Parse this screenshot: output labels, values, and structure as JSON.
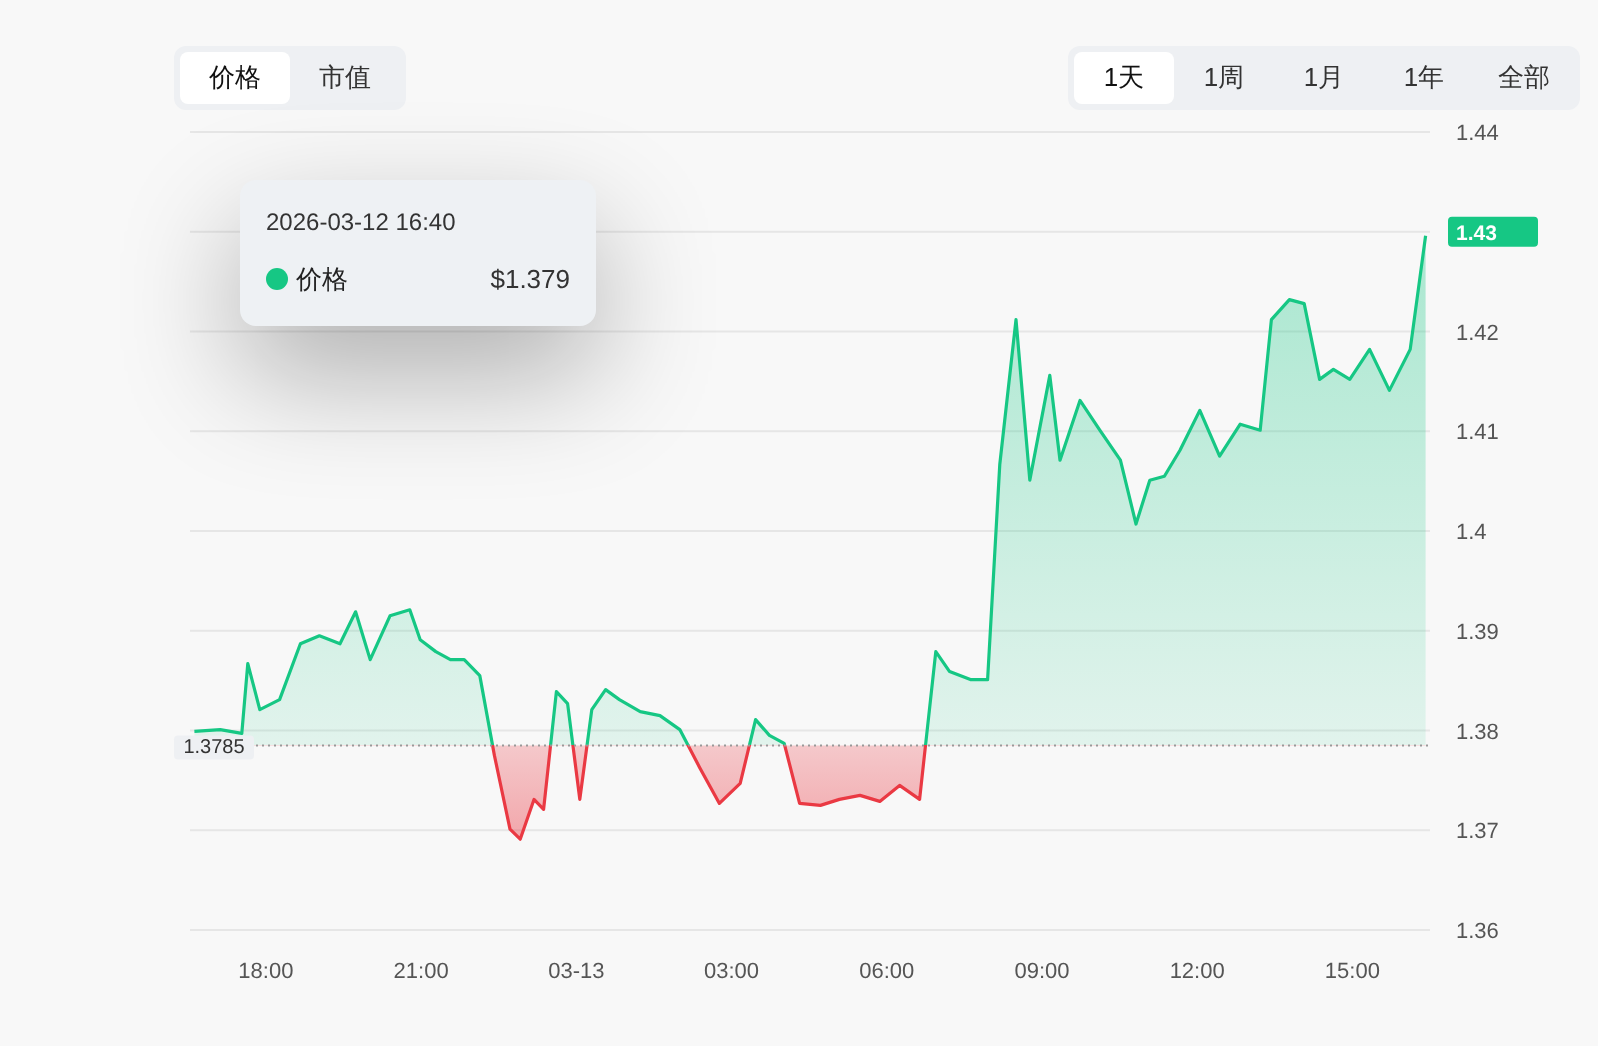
{
  "metric_tabs": [
    {
      "label": "价格",
      "selected": true
    },
    {
      "label": "市值",
      "selected": false
    }
  ],
  "range_tabs": [
    {
      "label": "1天",
      "selected": true
    },
    {
      "label": "1周",
      "selected": false
    },
    {
      "label": "1月",
      "selected": false
    },
    {
      "label": "1年",
      "selected": false
    },
    {
      "label": "全部",
      "selected": false
    }
  ],
  "chart": {
    "chart_data": {
      "type": "area",
      "grid": true,
      "ref_lines": [
        {
          "axis": "y",
          "value": 1.3785,
          "label": "1.3785"
        }
      ],
      "xlim": [
        "2026-03-12 16:32",
        "2026-03-13 16:30"
      ],
      "ylim": [
        1.36,
        1.44
      ],
      "x": [
        "2026-03-12 16:37",
        "2026-03-12 17:07",
        "2026-03-12 17:32",
        "2026-03-12 17:39",
        "2026-03-12 17:53",
        "2026-03-12 18:16",
        "2026-03-12 18:40",
        "2026-03-12 19:02",
        "2026-03-12 19:26",
        "2026-03-12 19:44",
        "2026-03-12 20:01",
        "2026-03-12 20:24",
        "2026-03-12 20:47",
        "2026-03-12 20:59",
        "2026-03-12 21:17",
        "2026-03-12 21:34",
        "2026-03-12 21:50",
        "2026-03-12 22:08",
        "2026-03-12 22:25",
        "2026-03-12 22:43",
        "2026-03-12 22:55",
        "2026-03-12 23:11",
        "2026-03-12 23:22",
        "2026-03-12 23:37",
        "2026-03-12 23:50",
        "2026-03-13 00:04",
        "2026-03-13 00:18",
        "2026-03-13 00:34",
        "2026-03-13 00:50",
        "2026-03-13 01:14",
        "2026-03-13 01:37",
        "2026-03-13 02:00",
        "2026-03-13 02:23",
        "2026-03-13 02:46",
        "2026-03-13 03:10",
        "2026-03-13 03:28",
        "2026-03-13 03:44",
        "2026-03-13 04:01",
        "2026-03-13 04:19",
        "2026-03-13 04:43",
        "2026-03-13 05:05",
        "2026-03-13 05:29",
        "2026-03-13 05:52",
        "2026-03-13 06:15",
        "2026-03-13 06:38",
        "2026-03-13 06:57",
        "2026-03-13 07:13",
        "2026-03-13 07:37",
        "2026-03-13 07:57",
        "2026-03-13 08:11",
        "2026-03-13 08:30",
        "2026-03-13 08:46",
        "2026-03-13 09:09",
        "2026-03-13 09:21",
        "2026-03-13 09:44",
        "2026-03-13 10:07",
        "2026-03-13 10:31",
        "2026-03-13 10:49",
        "2026-03-13 11:05",
        "2026-03-13 11:22",
        "2026-03-13 11:40",
        "2026-03-13 12:03",
        "2026-03-13 12:26",
        "2026-03-13 12:50",
        "2026-03-13 13:13",
        "2026-03-13 13:26",
        "2026-03-13 13:47",
        "2026-03-13 14:04",
        "2026-03-13 14:22",
        "2026-03-13 14:38",
        "2026-03-13 14:57",
        "2026-03-13 15:20",
        "2026-03-13 15:43",
        "2026-03-13 16:07",
        "2026-03-13 16:25"
      ],
      "series": [
        {
          "name": "价格",
          "color": "#16c784",
          "values": [
            1.3799,
            1.3801,
            1.3797,
            1.3867,
            1.3821,
            1.3831,
            1.3887,
            1.3895,
            1.3887,
            1.3919,
            1.3871,
            1.3915,
            1.3921,
            1.3891,
            1.3879,
            1.3871,
            1.3871,
            1.3855,
            1.3775,
            1.3701,
            1.3691,
            1.3731,
            1.3721,
            1.3839,
            1.3827,
            1.3731,
            1.3821,
            1.3841,
            1.3831,
            1.3819,
            1.3815,
            1.3801,
            1.3763,
            1.3727,
            1.3747,
            1.3811,
            1.3795,
            1.3787,
            1.3727,
            1.3725,
            1.3731,
            1.3735,
            1.3729,
            1.3745,
            1.3731,
            1.3879,
            1.3859,
            1.3851,
            1.3851,
            1.4067,
            1.4212,
            1.4051,
            1.4156,
            1.4071,
            1.4131,
            1.4101,
            1.4071,
            1.4007,
            1.4051,
            1.4055,
            1.4081,
            1.4121,
            1.4075,
            1.4107,
            1.4101,
            1.4212,
            1.4232,
            1.4228,
            1.4152,
            1.4162,
            1.4152,
            1.4182,
            1.4141,
            1.4182,
            1.4296
          ]
        }
      ],
      "xticks": [
        {
          "value": "2026-03-12 18:00",
          "label": "18:00"
        },
        {
          "value": "2026-03-12 21:00",
          "label": "21:00"
        },
        {
          "value": "2026-03-13 00:00",
          "label": "03-13"
        },
        {
          "value": "2026-03-13 03:00",
          "label": "03:00"
        },
        {
          "value": "2026-03-13 06:00",
          "label": "06:00"
        },
        {
          "value": "2026-03-13 09:00",
          "label": "09:00"
        },
        {
          "value": "2026-03-13 12:00",
          "label": "12:00"
        },
        {
          "value": "2026-03-13 15:00",
          "label": "15:00"
        }
      ],
      "yticks": [
        {
          "value": 1.36,
          "label": "1.36"
        },
        {
          "value": 1.37,
          "label": "1.37"
        },
        {
          "value": 1.38,
          "label": "1.38"
        },
        {
          "value": 1.39,
          "label": "1.39"
        },
        {
          "value": 1.4,
          "label": "1.4"
        },
        {
          "value": 1.41,
          "label": "1.41"
        },
        {
          "value": 1.42,
          "label": "1.42"
        },
        {
          "value": 1.43,
          "label": "1.43"
        },
        {
          "value": 1.44,
          "label": "1.44"
        }
      ]
    },
    "last_price_badge": "1.43",
    "tooltip": {
      "time": "2026-03-12 16:40",
      "value": "$1.379"
    }
  }
}
